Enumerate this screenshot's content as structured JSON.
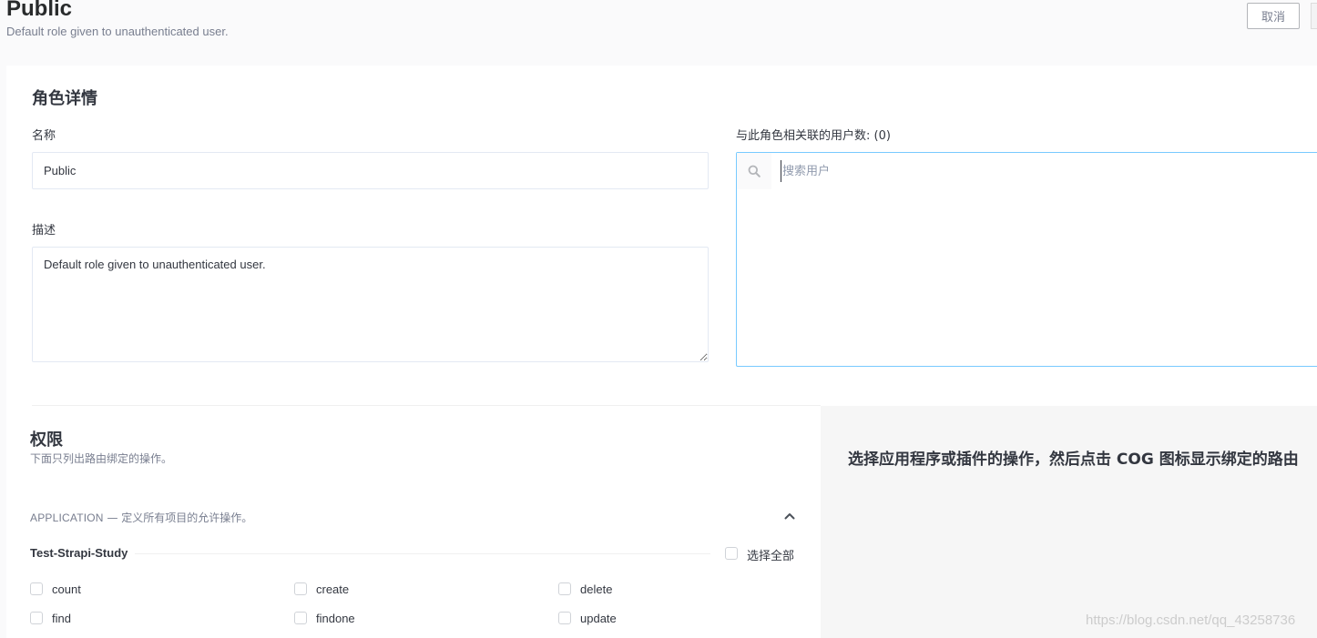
{
  "header": {
    "title": "Public",
    "subtitle": "Default role given to unauthenticated user.",
    "cancel_label": "取消"
  },
  "details": {
    "section_title": "角色详情",
    "name_label": "名称",
    "name_value": "Public",
    "description_label": "描述",
    "description_value": "Default role given to unauthenticated user.",
    "users_label": "与此角色相关联的用户数: (0)",
    "search_placeholder": "搜索用户"
  },
  "permissions": {
    "title": "权限",
    "subtitle": "下面只列出路由绑定的操作。",
    "application_name": "APPLICATION",
    "application_desc": " — 定义所有项目的允许操作。",
    "plugin_name": "Test-Strapi-Study",
    "select_all_label": "选择全部",
    "actions": [
      {
        "label": "count"
      },
      {
        "label": "create"
      },
      {
        "label": "delete"
      },
      {
        "label": "find"
      },
      {
        "label": "findone"
      },
      {
        "label": "update"
      }
    ]
  },
  "right_panel": {
    "hint": "选择应用程序或插件的操作，然后点击 COG 图标显示绑定的路由"
  },
  "watermark": "https://blog.csdn.net/qq_43258736",
  "colors": {
    "input_focus_border": "#78caff",
    "input_border": "#e3e9f3",
    "muted_text": "#787e8f"
  }
}
